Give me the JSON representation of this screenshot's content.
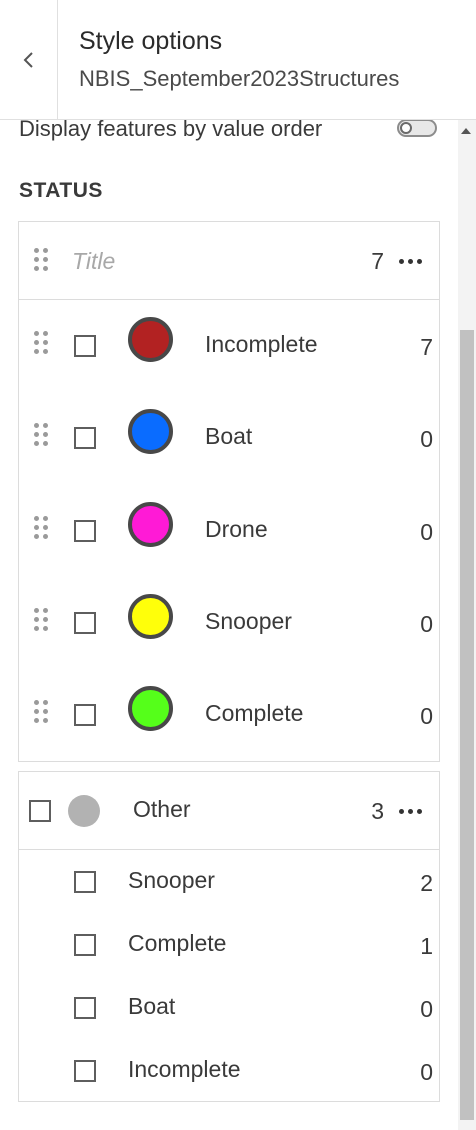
{
  "header": {
    "title": "Style options",
    "subtitle": "NBIS_September2023Structures"
  },
  "toggle": {
    "label": "Display features by value order",
    "enabled": false
  },
  "section": {
    "title": "STATUS"
  },
  "group": {
    "title_placeholder": "Title",
    "count": "7",
    "categories": [
      {
        "label": "Incomplete",
        "count": "7",
        "color": "#b22222"
      },
      {
        "label": "Boat",
        "count": "0",
        "color": "#0a6cff"
      },
      {
        "label": "Drone",
        "count": "0",
        "color": "#ff1ad6"
      },
      {
        "label": "Snooper",
        "count": "0",
        "color": "#ffff0a"
      },
      {
        "label": "Complete",
        "count": "0",
        "color": "#55ff1a"
      }
    ]
  },
  "other": {
    "label": "Other",
    "count": "3",
    "color": "#b2b2b2",
    "items": [
      {
        "label": "Snooper",
        "count": "2"
      },
      {
        "label": "Complete",
        "count": "1"
      },
      {
        "label": "Boat",
        "count": "0"
      },
      {
        "label": "Incomplete",
        "count": "0"
      }
    ]
  },
  "icons": {
    "back": "chevron-left-icon",
    "more": "ellipsis-icon",
    "drag": "drag-handle-icon"
  }
}
